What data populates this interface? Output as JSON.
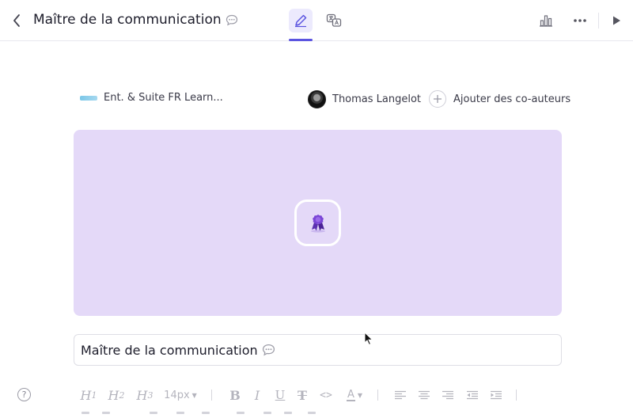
{
  "header": {
    "title": "Maître de la communication",
    "tabs": [
      {
        "name": "edit",
        "icon": "pencil-icon",
        "active": true
      },
      {
        "name": "translate",
        "icon": "translate-icon",
        "active": false
      }
    ],
    "actions": [
      "bar-chart-icon",
      "more-icon",
      "play-icon"
    ]
  },
  "meta": {
    "workspace_label": "Ent. & Suite FR Learn...",
    "author_name": "Thomas Langelot",
    "add_coauthors_label": "Ajouter des co-auteurs"
  },
  "cover": {
    "background_color": "#e4d9f8",
    "icon": "award-ribbon-icon"
  },
  "title_field": {
    "value": "Maître de la communication"
  },
  "toolbar": {
    "h1": "H",
    "h1_sub": "1",
    "h2": "H",
    "h2_sub": "2",
    "h3": "H",
    "h3_sub": "3",
    "font_size": "14px",
    "bold": "B",
    "italic": "I",
    "underline": "U",
    "strikethrough": "T",
    "code": "<>",
    "text_color": "A"
  },
  "colors": {
    "accent": "#5b54e0",
    "active_tab_bg": "#eceafd",
    "toolbar_icon": "#b4b4bd"
  }
}
